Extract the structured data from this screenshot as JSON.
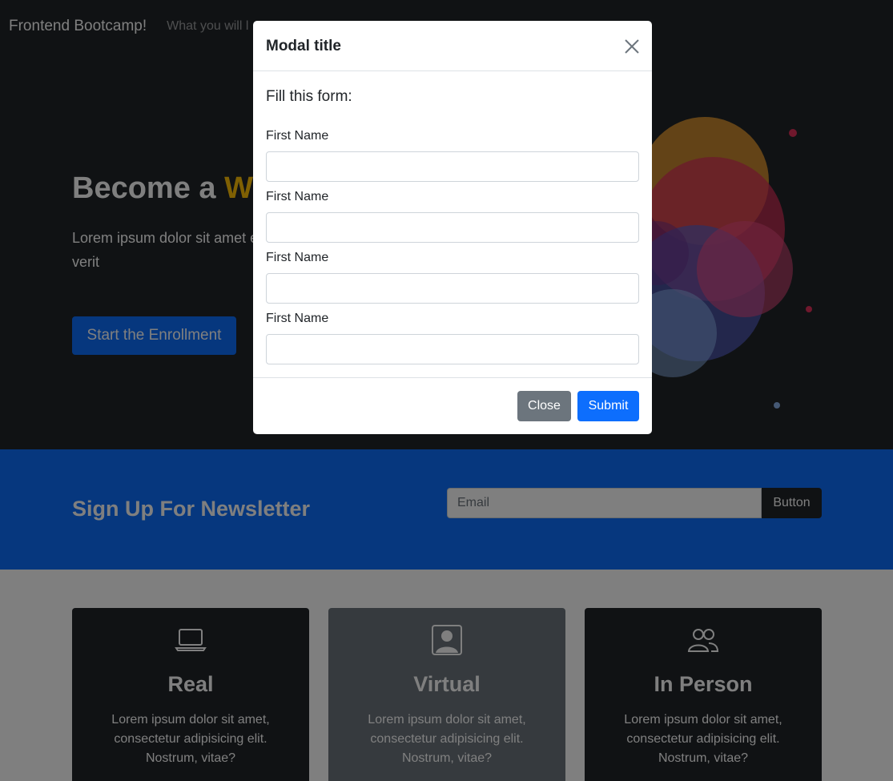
{
  "navbar": {
    "brand": "Frontend Bootcamp!",
    "links": [
      "What you will l"
    ]
  },
  "hero": {
    "title_prefix": "Become a ",
    "title_accent": "We",
    "paragraph": "Lorem ipsum dolor sit amet elit. A amet at illum minima optio quia temporibus verit",
    "cta_label": "Start the Enrollment"
  },
  "newsletter": {
    "heading": "Sign Up For Newsletter",
    "email_placeholder": "Email",
    "button_label": "Button"
  },
  "cards": [
    {
      "icon": "laptop-icon",
      "title": "Real",
      "text": "Lorem ipsum dolor sit amet, consectetur adipisicing elit. Nostrum, vitae?"
    },
    {
      "icon": "person-square-icon",
      "title": "Virtual",
      "text": "Lorem ipsum dolor sit amet, consectetur adipisicing elit. Nostrum, vitae?"
    },
    {
      "icon": "people-icon",
      "title": "In Person",
      "text": "Lorem ipsum dolor sit amet, consectetur adipisicing elit. Nostrum, vitae?"
    }
  ],
  "modal": {
    "title": "Modal title",
    "intro": "Fill this form:",
    "fields": [
      {
        "label": "First Name",
        "value": ""
      },
      {
        "label": "First Name",
        "value": ""
      },
      {
        "label": "First Name",
        "value": ""
      },
      {
        "label": "First Name",
        "value": ""
      }
    ],
    "close_label": "Close",
    "submit_label": "Submit"
  },
  "colors": {
    "dark": "#212529",
    "primary": "#0d6efd",
    "secondary": "#6c757d",
    "warning": "#ffc107"
  }
}
